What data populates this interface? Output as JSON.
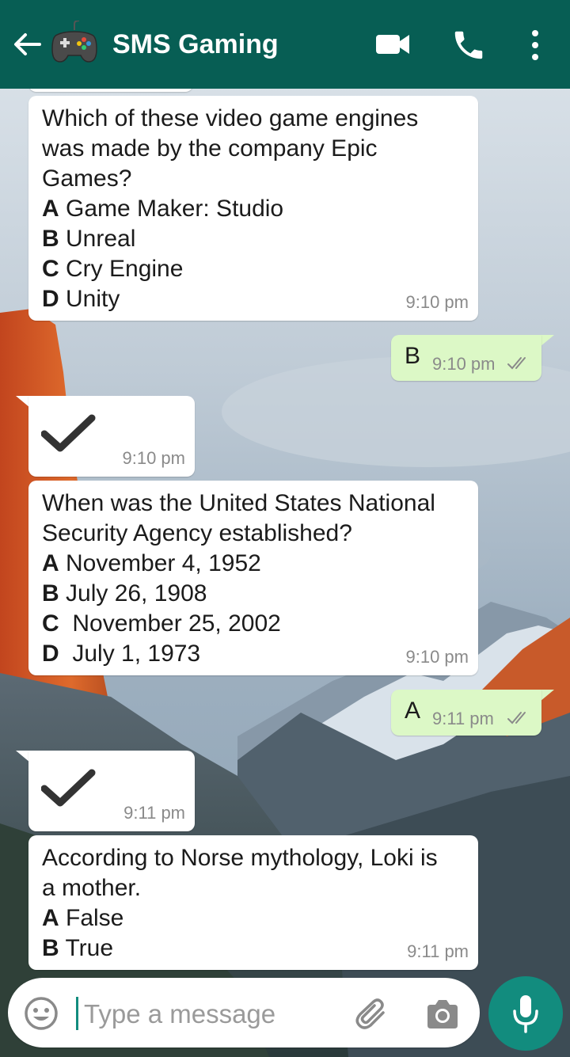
{
  "header": {
    "title": "SMS Gaming",
    "back_icon": "arrow-back-icon",
    "avatar_icon": "gamepad-icon",
    "actions": [
      "video-call-icon",
      "phone-icon",
      "more-vert-icon"
    ],
    "color": "#075e54"
  },
  "messages": [
    {
      "direction": "in",
      "question": "Which of these video game engines was made by the company Epic Games?",
      "question_lines": [
        "Which of these video game engines",
        "was made by the company Epic",
        "Games?"
      ],
      "options": [
        {
          "letter": "A",
          "text": " Game Maker: Studio"
        },
        {
          "letter": "B",
          "text": " Unreal"
        },
        {
          "letter": "C",
          "text": " Cry Engine"
        },
        {
          "letter": "D",
          "text": " Unity"
        }
      ],
      "time": "9:10 pm"
    },
    {
      "direction": "out",
      "text": "B",
      "time": "9:10 pm",
      "status": "read"
    },
    {
      "direction": "in",
      "icon": "checkmark-icon",
      "time": "9:10 pm"
    },
    {
      "direction": "in",
      "question": "When was the United States National Security Agency established?",
      "question_lines": [
        "When was the United States National",
        "Security Agency established?"
      ],
      "options": [
        {
          "letter": "A",
          "text": " November 4, 1952"
        },
        {
          "letter": "B",
          "text": " July 26, 1908"
        },
        {
          "letter": "C",
          "text": "  November 25, 2002"
        },
        {
          "letter": "D",
          "text": "  July 1, 1973"
        }
      ],
      "time": "9:10 pm"
    },
    {
      "direction": "out",
      "text": "A",
      "time": "9:11 pm",
      "status": "read"
    },
    {
      "direction": "in",
      "icon": "checkmark-icon",
      "time": "9:11 pm"
    },
    {
      "direction": "in",
      "question": "According to Norse mythology, Loki is a mother.",
      "question_lines": [
        "According to Norse mythology, Loki is",
        "a mother."
      ],
      "options": [
        {
          "letter": "A",
          "text": " False"
        },
        {
          "letter": "B",
          "text": " True"
        }
      ],
      "time": "9:11 pm"
    }
  ],
  "composer": {
    "placeholder": "Type a message",
    "value": "",
    "icons": [
      "emoji-icon",
      "attach-icon",
      "camera-icon",
      "mic-icon"
    ],
    "mic_color": "#128c7e"
  },
  "colors": {
    "incoming": "#ffffff",
    "outgoing": "#dcf8c6",
    "read_ticks": "#8a8a8a"
  }
}
